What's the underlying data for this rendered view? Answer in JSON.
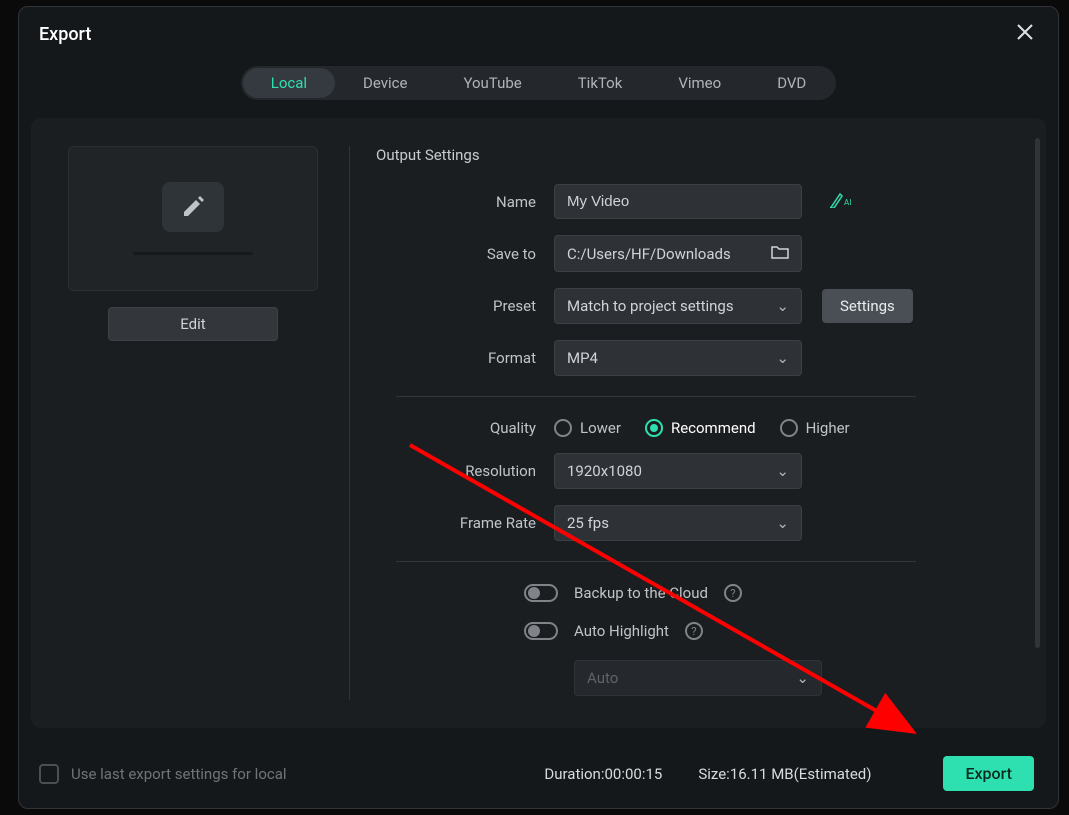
{
  "dialog": {
    "title": "Export",
    "tabs": [
      "Local",
      "Device",
      "YouTube",
      "TikTok",
      "Vimeo",
      "DVD"
    ],
    "activeTab": 0
  },
  "preview": {
    "editButton": "Edit"
  },
  "form": {
    "sectionTitle": "Output Settings",
    "name": {
      "label": "Name",
      "value": "My Video"
    },
    "saveTo": {
      "label": "Save to",
      "value": "C:/Users/HF/Downloads"
    },
    "preset": {
      "label": "Preset",
      "value": "Match to project settings",
      "settingsBtn": "Settings"
    },
    "format": {
      "label": "Format",
      "value": "MP4"
    },
    "quality": {
      "label": "Quality",
      "options": [
        "Lower",
        "Recommend",
        "Higher"
      ],
      "selected": 1
    },
    "resolution": {
      "label": "Resolution",
      "value": "1920x1080"
    },
    "frameRate": {
      "label": "Frame Rate",
      "value": "25 fps"
    },
    "backup": {
      "label": "Backup to the Cloud",
      "enabled": false
    },
    "autoHighlight": {
      "label": "Auto Highlight",
      "enabled": false,
      "value": "Auto"
    }
  },
  "footer": {
    "useLastSettings": "Use last export settings for local",
    "duration": {
      "label": "Duration:",
      "value": "00:00:15"
    },
    "size": {
      "label": "Size:",
      "value": "16.11 MB",
      "estimated": "(Estimated)"
    },
    "exportBtn": "Export"
  }
}
